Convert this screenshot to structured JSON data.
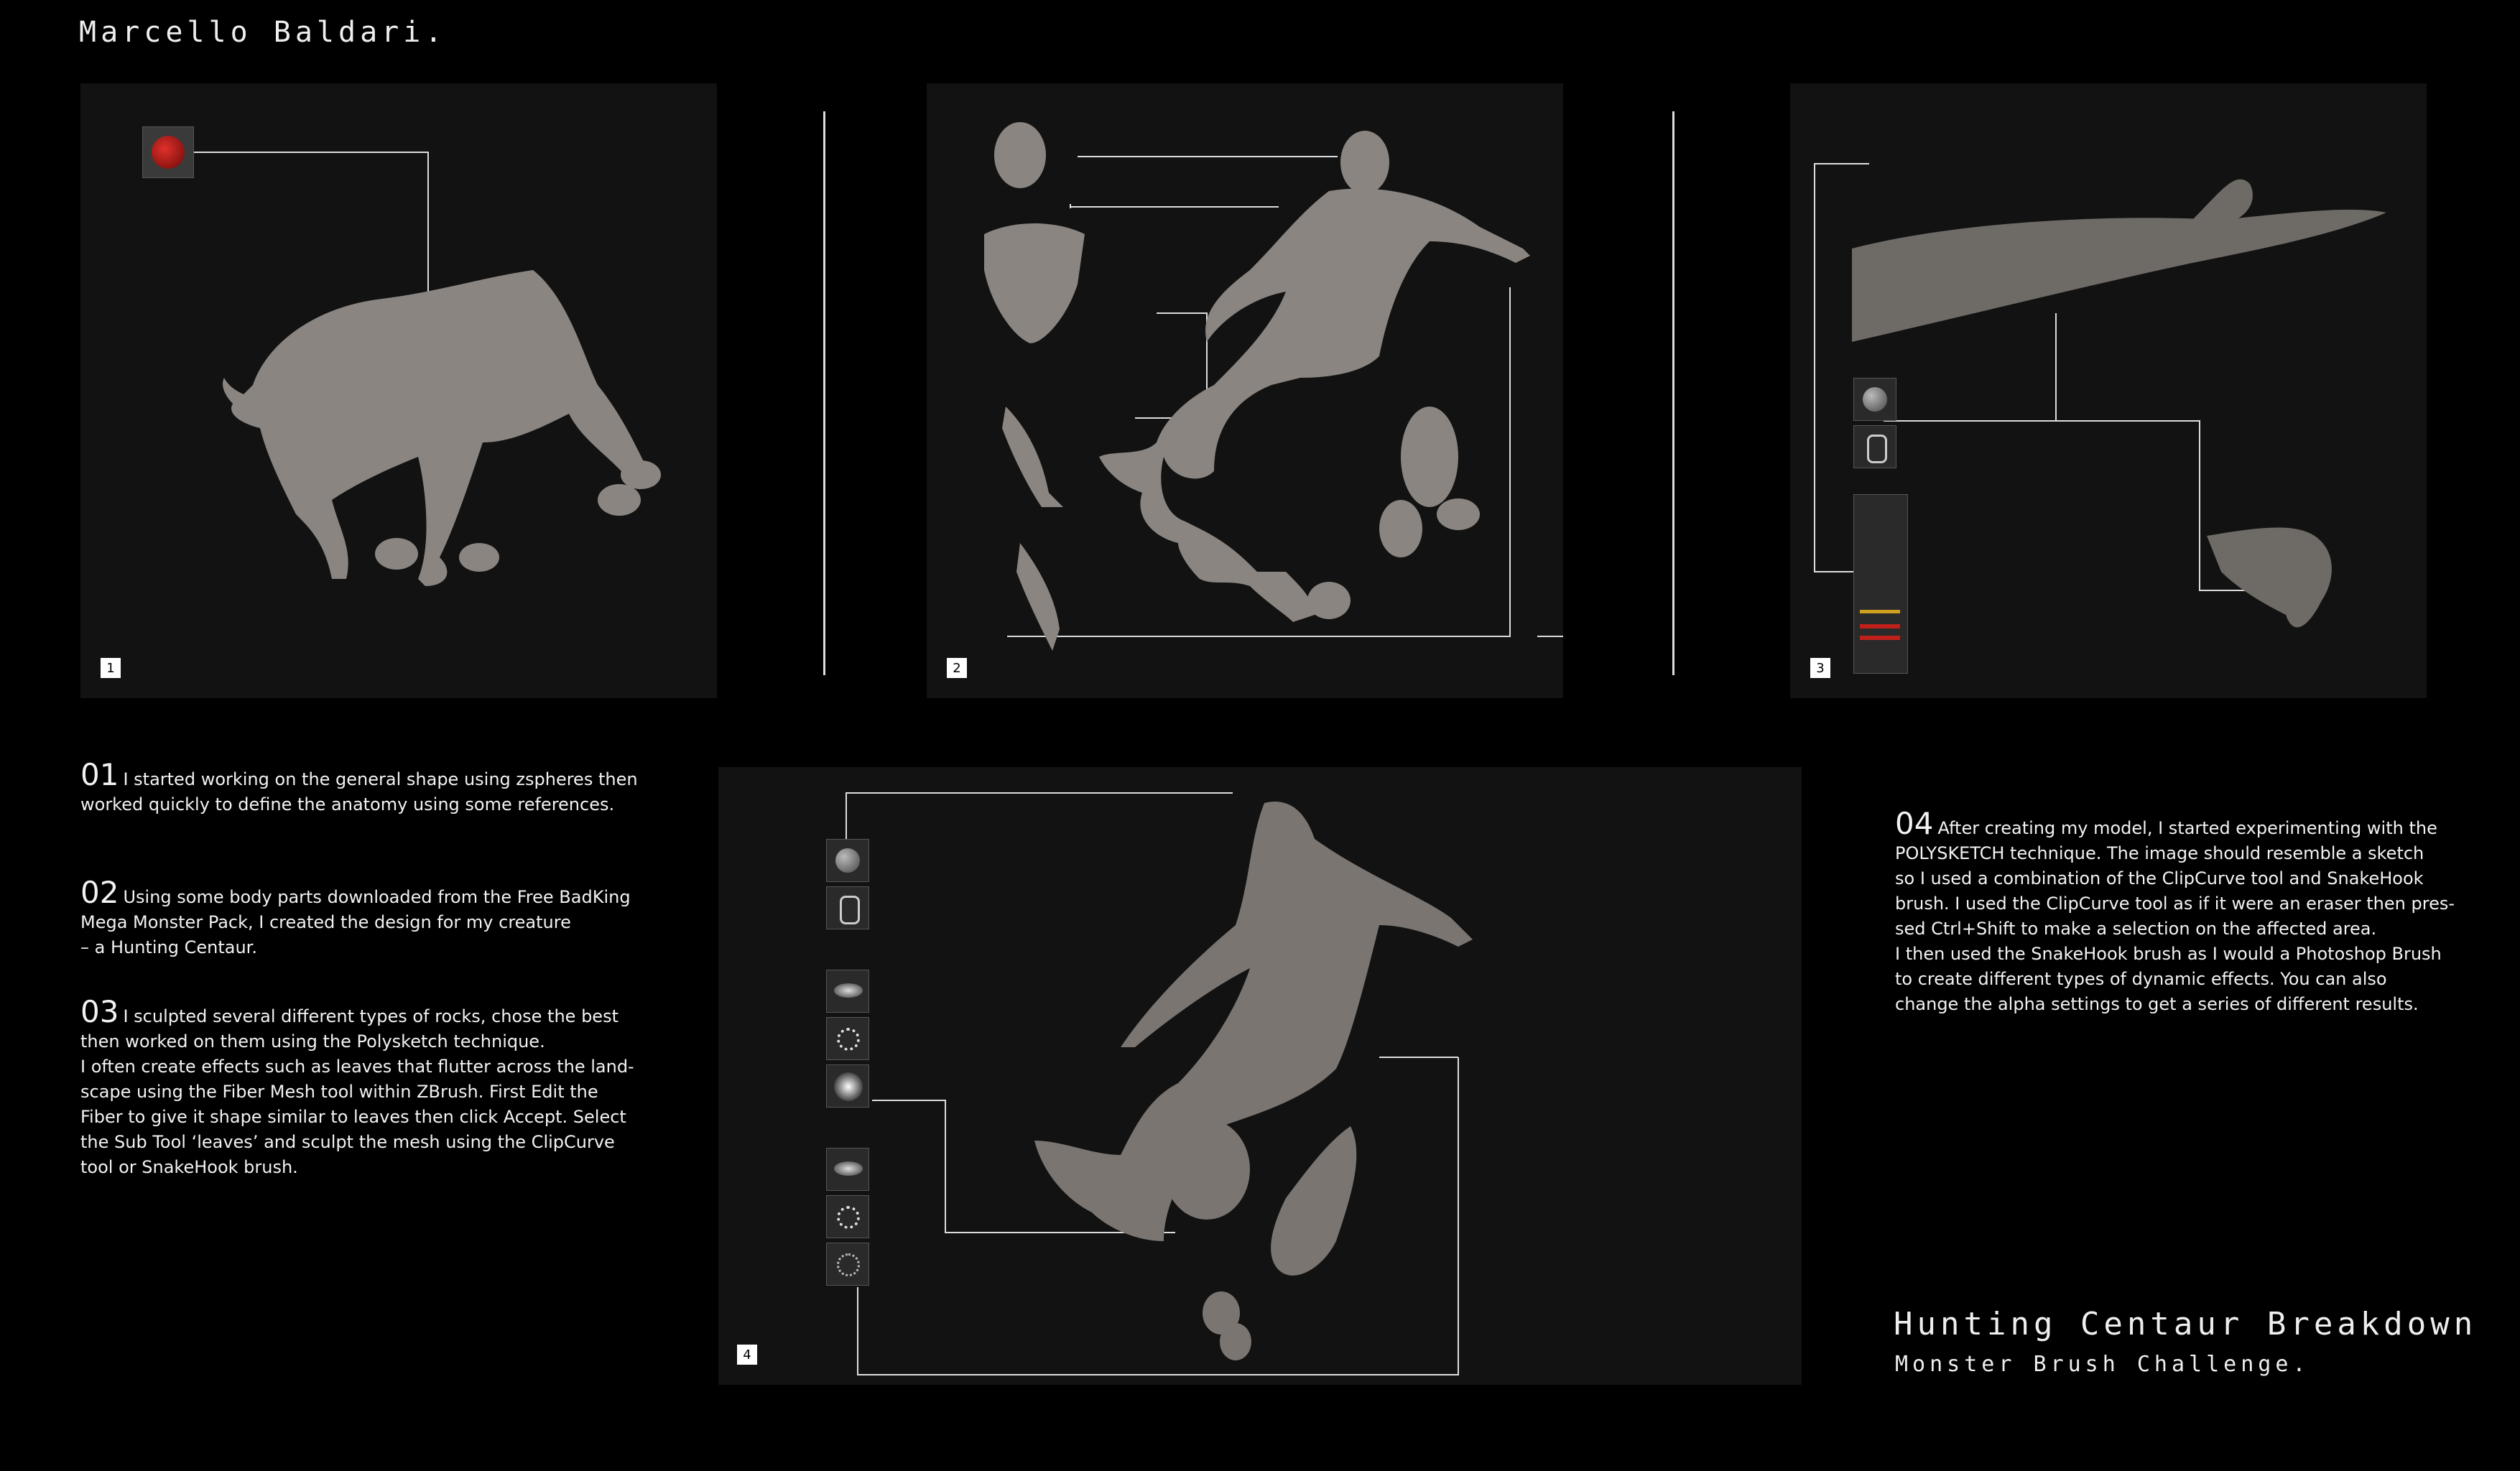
{
  "author": "Marcello Baldari.",
  "panels": [
    {
      "number": "1"
    },
    {
      "number": "2"
    },
    {
      "number": "3"
    },
    {
      "number": "4"
    }
  ],
  "steps": [
    {
      "num": "01",
      "lines": [
        "I started working on the general shape using zspheres then",
        "worked quickly to define the anatomy using some references."
      ]
    },
    {
      "num": "02",
      "lines": [
        "Using some body parts downloaded from the Free BadKing",
        "Mega Monster Pack, I created the design for my creature",
        "– a Hunting Centaur."
      ]
    },
    {
      "num": "03",
      "lines": [
        "I sculpted several different types of rocks, chose the best",
        "then worked on them using the Polysketch technique.",
        "I often create effects such as leaves that flutter across the land-",
        "scape using the Fiber Mesh tool within ZBrush. First Edit the",
        "Fiber to give it shape similar to leaves then click Accept. Select",
        "the Sub Tool ‘leaves’ and sculpt the mesh using the ClipCurve",
        "tool or SnakeHook brush."
      ]
    },
    {
      "num": "04",
      "lines": [
        "After creating my model, I started experimenting with the",
        "POLYSKETCH technique. The image should resemble a sketch",
        "so I used a combination of the ClipCurve tool and SnakeHook",
        "brush. I used the ClipCurve tool as if it were an eraser then pres-",
        "sed Ctrl+Shift to make a selection on the affected area.",
        "I then used the SnakeHook brush as I would a Photoshop Brush",
        "to create different types of dynamic effects. You can also",
        "change the alpha settings to get a series of different results."
      ]
    }
  ],
  "footer": {
    "title": "Hunting Centaur Breakdown",
    "subtitle": "Monster Brush Challenge."
  },
  "colors": {
    "background": "#000000",
    "panel": "#121212",
    "sculpt": "#8a8580",
    "accent_red": "#c0201a"
  }
}
